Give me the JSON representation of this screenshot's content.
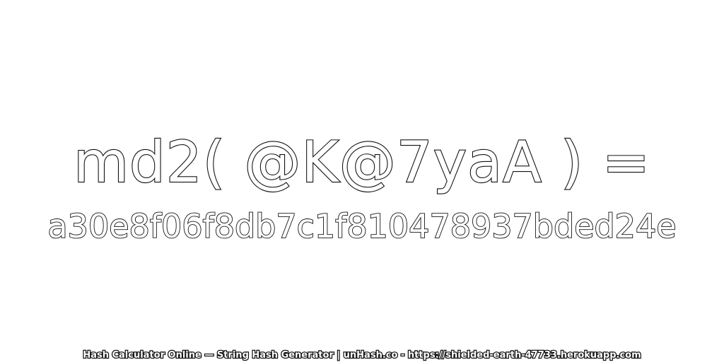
{
  "expression": "md2( @K@7yaA ) =",
  "hash": "a30e8f06f8db7c1f810478937bded24e",
  "footer": "Hash Calculator Online — String Hash Generator | unHash.co - https://shielded-earth-47733.herokuapp.com"
}
